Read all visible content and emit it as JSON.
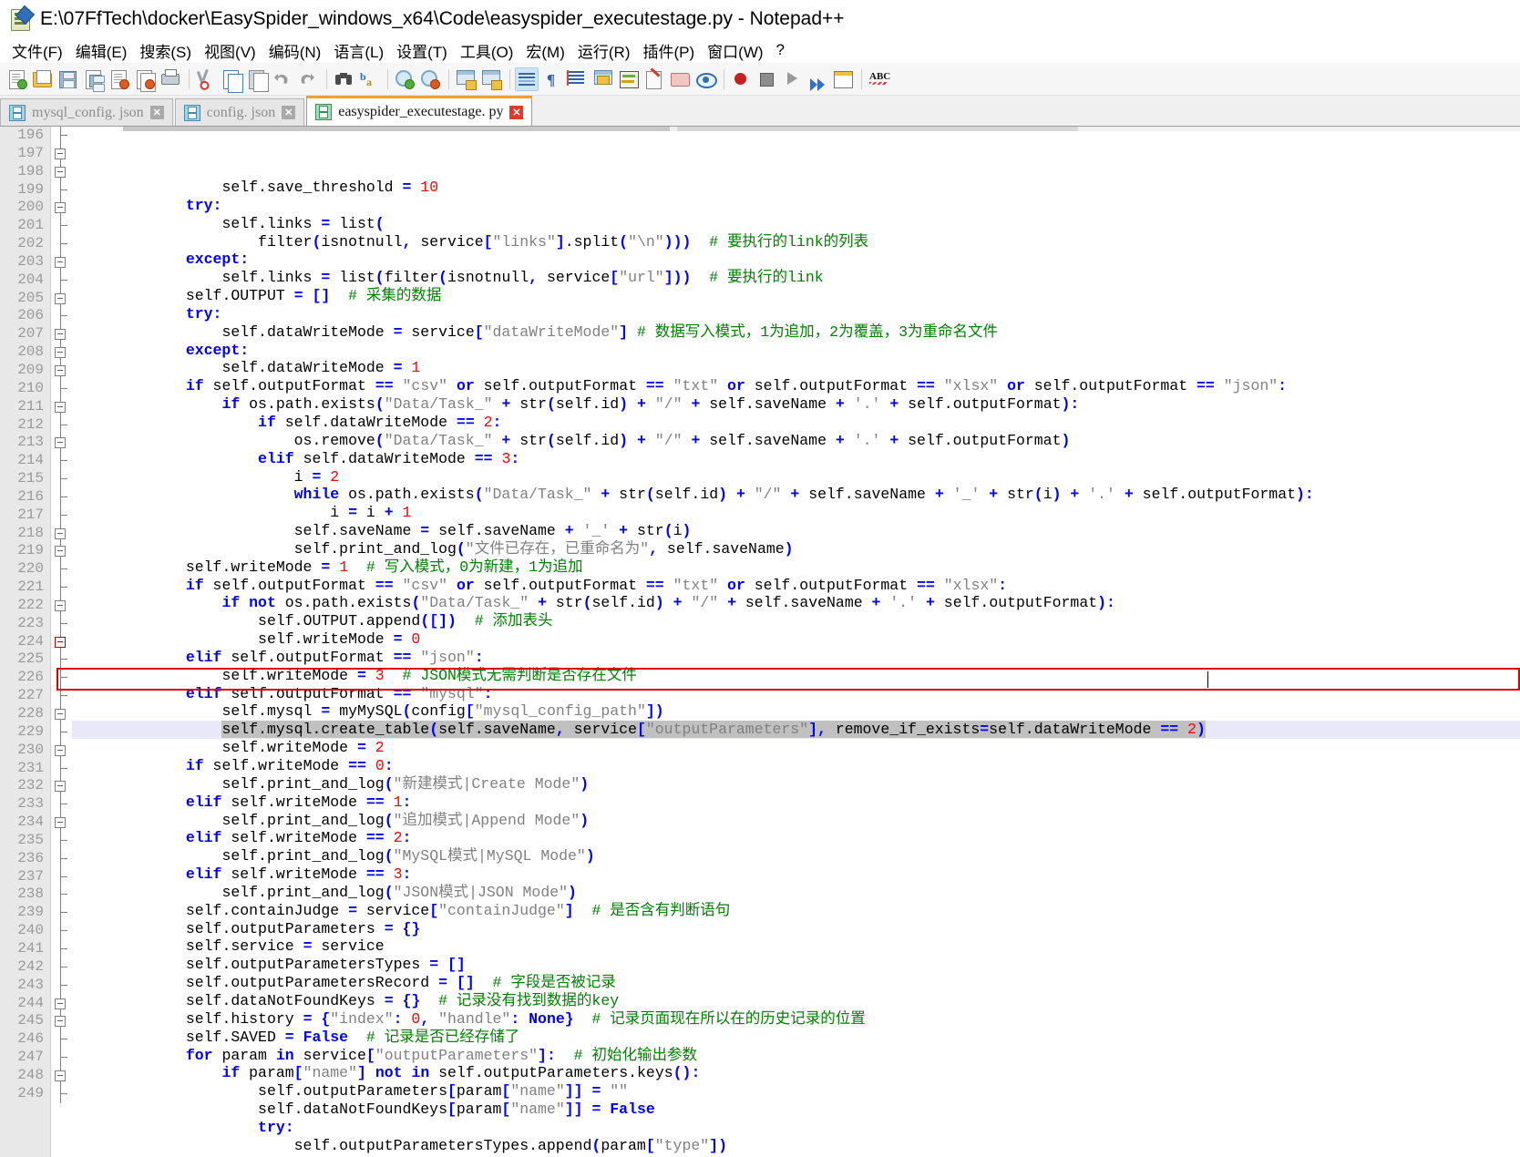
{
  "window": {
    "title": "E:\\07FfTech\\docker\\EasySpider_windows_x64\\Code\\easyspider_executestage.py - Notepad++",
    "app_icon": "notepad-plus-plus-icon"
  },
  "menu": {
    "items": [
      {
        "label": "文件(F)",
        "name": "menu-file"
      },
      {
        "label": "编辑(E)",
        "name": "menu-edit"
      },
      {
        "label": "搜索(S)",
        "name": "menu-search"
      },
      {
        "label": "视图(V)",
        "name": "menu-view"
      },
      {
        "label": "编码(N)",
        "name": "menu-encoding"
      },
      {
        "label": "语言(L)",
        "name": "menu-language"
      },
      {
        "label": "设置(T)",
        "name": "menu-settings"
      },
      {
        "label": "工具(O)",
        "name": "menu-tools"
      },
      {
        "label": "宏(M)",
        "name": "menu-macro"
      },
      {
        "label": "运行(R)",
        "name": "menu-run"
      },
      {
        "label": "插件(P)",
        "name": "menu-plugins"
      },
      {
        "label": "窗口(W)",
        "name": "menu-window"
      },
      {
        "label": "?",
        "name": "menu-help"
      }
    ]
  },
  "toolbar": {
    "icons": [
      "new-file-icon",
      "open-file-icon",
      "save-icon",
      "save-all-icon",
      "close-file-icon",
      "close-all-icon",
      "print-icon",
      "cut-icon",
      "copy-icon",
      "paste-icon",
      "undo-icon",
      "redo-icon",
      "find-icon",
      "replace-icon",
      "zoom-in-icon",
      "zoom-out-icon",
      "sync-vertical-scroll-icon",
      "sync-horizontal-scroll-icon",
      "word-wrap-icon",
      "show-all-characters-icon",
      "indent-guide-icon",
      "ui-interface-icon",
      "document-map-icon",
      "function-list-icon",
      "folder-as-workspace-icon",
      "monitoring-icon",
      "macro-record-icon",
      "macro-stop-icon",
      "macro-play-icon",
      "macro-run-multiple-icon",
      "run-macro-dialog-icon",
      "spell-check-icon"
    ]
  },
  "tabs": [
    {
      "label": "mysql_config. json",
      "name": "tab-mysql-config-json",
      "active": false,
      "close": "✕"
    },
    {
      "label": "config. json",
      "name": "tab-config-json",
      "active": false,
      "close": "✕"
    },
    {
      "label": "easyspider_executestage. py",
      "name": "tab-easyspider-executestage-py",
      "active": true,
      "close": "✕"
    }
  ],
  "editor": {
    "first_line_number": 196,
    "highlighted_line_number": 226,
    "caret_line_number": 226,
    "lines": [
      {
        "n": 196,
        "fold": "tick",
        "text": "                self.save_threshold = 10"
      },
      {
        "n": 197,
        "fold": "box",
        "text": "            try:"
      },
      {
        "n": 198,
        "fold": "box",
        "text": "                self.links = list("
      },
      {
        "n": 199,
        "fold": "tick",
        "text": "                    filter(isnotnull, service[\"links\"].split(\"\\n\")))  # 要执行的link的列表"
      },
      {
        "n": 200,
        "fold": "box",
        "text": "            except:"
      },
      {
        "n": 201,
        "fold": "tick",
        "text": "                self.links = list(filter(isnotnull, service[\"url\"]))  # 要执行的link"
      },
      {
        "n": 202,
        "fold": "tick",
        "text": "            self.OUTPUT = []  # 采集的数据"
      },
      {
        "n": 203,
        "fold": "box",
        "text": "            try:"
      },
      {
        "n": 204,
        "fold": "tick",
        "text": "                self.dataWriteMode = service[\"dataWriteMode\"] # 数据写入模式，1为追加，2为覆盖，3为重命名文件"
      },
      {
        "n": 205,
        "fold": "box",
        "text": "            except:"
      },
      {
        "n": 206,
        "fold": "tick",
        "text": "                self.dataWriteMode = 1"
      },
      {
        "n": 207,
        "fold": "box",
        "text": "            if self.outputFormat == \"csv\" or self.outputFormat == \"txt\" or self.outputFormat == \"xlsx\" or self.outputFormat == \"json\":"
      },
      {
        "n": 208,
        "fold": "box",
        "text": "                if os.path.exists(\"Data/Task_\" + str(self.id) + \"/\" + self.saveName + '.' + self.outputFormat):"
      },
      {
        "n": 209,
        "fold": "box",
        "text": "                    if self.dataWriteMode == 2:"
      },
      {
        "n": 210,
        "fold": "tick",
        "text": "                        os.remove(\"Data/Task_\" + str(self.id) + \"/\" + self.saveName + '.' + self.outputFormat)"
      },
      {
        "n": 211,
        "fold": "box",
        "text": "                    elif self.dataWriteMode == 3:"
      },
      {
        "n": 212,
        "fold": "tick",
        "text": "                        i = 2"
      },
      {
        "n": 213,
        "fold": "box",
        "text": "                        while os.path.exists(\"Data/Task_\" + str(self.id) + \"/\" + self.saveName + '_' + str(i) + '.' + self.outputFormat):"
      },
      {
        "n": 214,
        "fold": "tick",
        "text": "                            i = i + 1"
      },
      {
        "n": 215,
        "fold": "tick",
        "text": "                        self.saveName = self.saveName + '_' + str(i)"
      },
      {
        "n": 216,
        "fold": "tick",
        "text": "                        self.print_and_log(\"文件已存在，已重命名为\", self.saveName)"
      },
      {
        "n": 217,
        "fold": "tick",
        "text": "            self.writeMode = 1  # 写入模式，0为新建，1为追加"
      },
      {
        "n": 218,
        "fold": "box",
        "text": "            if self.outputFormat == \"csv\" or self.outputFormat == \"txt\" or self.outputFormat == \"xlsx\":"
      },
      {
        "n": 219,
        "fold": "box",
        "text": "                if not os.path.exists(\"Data/Task_\" + str(self.id) + \"/\" + self.saveName + '.' + self.outputFormat):"
      },
      {
        "n": 220,
        "fold": "tick",
        "text": "                    self.OUTPUT.append([])  # 添加表头"
      },
      {
        "n": 221,
        "fold": "tick",
        "text": "                    self.writeMode = 0"
      },
      {
        "n": 222,
        "fold": "box",
        "text": "            elif self.outputFormat == \"json\":"
      },
      {
        "n": 223,
        "fold": "tick",
        "text": "                self.writeMode = 3  # JSON模式无需判断是否存在文件"
      },
      {
        "n": 224,
        "fold": "boxred",
        "text": "            elif self.outputFormat == \"mysql\":"
      },
      {
        "n": 225,
        "fold": "tick",
        "text": "                self.mysql = myMySQL(config[\"mysql_config_path\"])"
      },
      {
        "n": 226,
        "fold": "tick",
        "text": "                self.mysql.create_table(self.saveName, service[\"outputParameters\"], remove_if_exists=self.dataWriteMode == 2)"
      },
      {
        "n": 227,
        "fold": "tick",
        "text": "                self.writeMode = 2"
      },
      {
        "n": 228,
        "fold": "box",
        "text": "            if self.writeMode == 0:"
      },
      {
        "n": 229,
        "fold": "tick",
        "text": "                self.print_and_log(\"新建模式|Create Mode\")"
      },
      {
        "n": 230,
        "fold": "box",
        "text": "            elif self.writeMode == 1:"
      },
      {
        "n": 231,
        "fold": "tick",
        "text": "                self.print_and_log(\"追加模式|Append Mode\")"
      },
      {
        "n": 232,
        "fold": "box",
        "text": "            elif self.writeMode == 2:"
      },
      {
        "n": 233,
        "fold": "tick",
        "text": "                self.print_and_log(\"MySQL模式|MySQL Mode\")"
      },
      {
        "n": 234,
        "fold": "box",
        "text": "            elif self.writeMode == 3:"
      },
      {
        "n": 235,
        "fold": "tick",
        "text": "                self.print_and_log(\"JSON模式|JSON Mode\")"
      },
      {
        "n": 236,
        "fold": "tick",
        "text": "            self.containJudge = service[\"containJudge\"]  # 是否含有判断语句"
      },
      {
        "n": 237,
        "fold": "tick",
        "text": "            self.outputParameters = {}"
      },
      {
        "n": 238,
        "fold": "tick",
        "text": "            self.service = service"
      },
      {
        "n": 239,
        "fold": "tick",
        "text": "            self.outputParametersTypes = []"
      },
      {
        "n": 240,
        "fold": "tick",
        "text": "            self.outputParametersRecord = []  # 字段是否被记录"
      },
      {
        "n": 241,
        "fold": "tick",
        "text": "            self.dataNotFoundKeys = {}  # 记录没有找到数据的key"
      },
      {
        "n": 242,
        "fold": "tick",
        "text": "            self.history = {\"index\": 0, \"handle\": None}  # 记录页面现在所以在的历史记录的位置"
      },
      {
        "n": 243,
        "fold": "tick",
        "text": "            self.SAVED = False  # 记录是否已经存储了"
      },
      {
        "n": 244,
        "fold": "box",
        "text": "            for param in service[\"outputParameters\"]:  # 初始化输出参数"
      },
      {
        "n": 245,
        "fold": "box",
        "text": "                if param[\"name\"] not in self.outputParameters.keys():"
      },
      {
        "n": 246,
        "fold": "tick",
        "text": "                    self.outputParameters[param[\"name\"]] = \"\""
      },
      {
        "n": 247,
        "fold": "tick",
        "text": "                    self.dataNotFoundKeys[param[\"name\"]] = False"
      },
      {
        "n": 248,
        "fold": "box",
        "text": "                    try:"
      },
      {
        "n": 249,
        "fold": "tick",
        "text": "                        self.outputParametersTypes.append(param[\"type\"])"
      }
    ]
  },
  "colors": {
    "keyword": "#0000ff",
    "number": "#ff0000",
    "string": "#808080",
    "comment": "#008000",
    "plain": "#000000",
    "selection": "#c0c0c0",
    "current_line": "#e8e8f8",
    "red_box_border": "#e00000",
    "active_tab_accent": "#f0a030",
    "gutter_bg": "#e8e8e8"
  }
}
